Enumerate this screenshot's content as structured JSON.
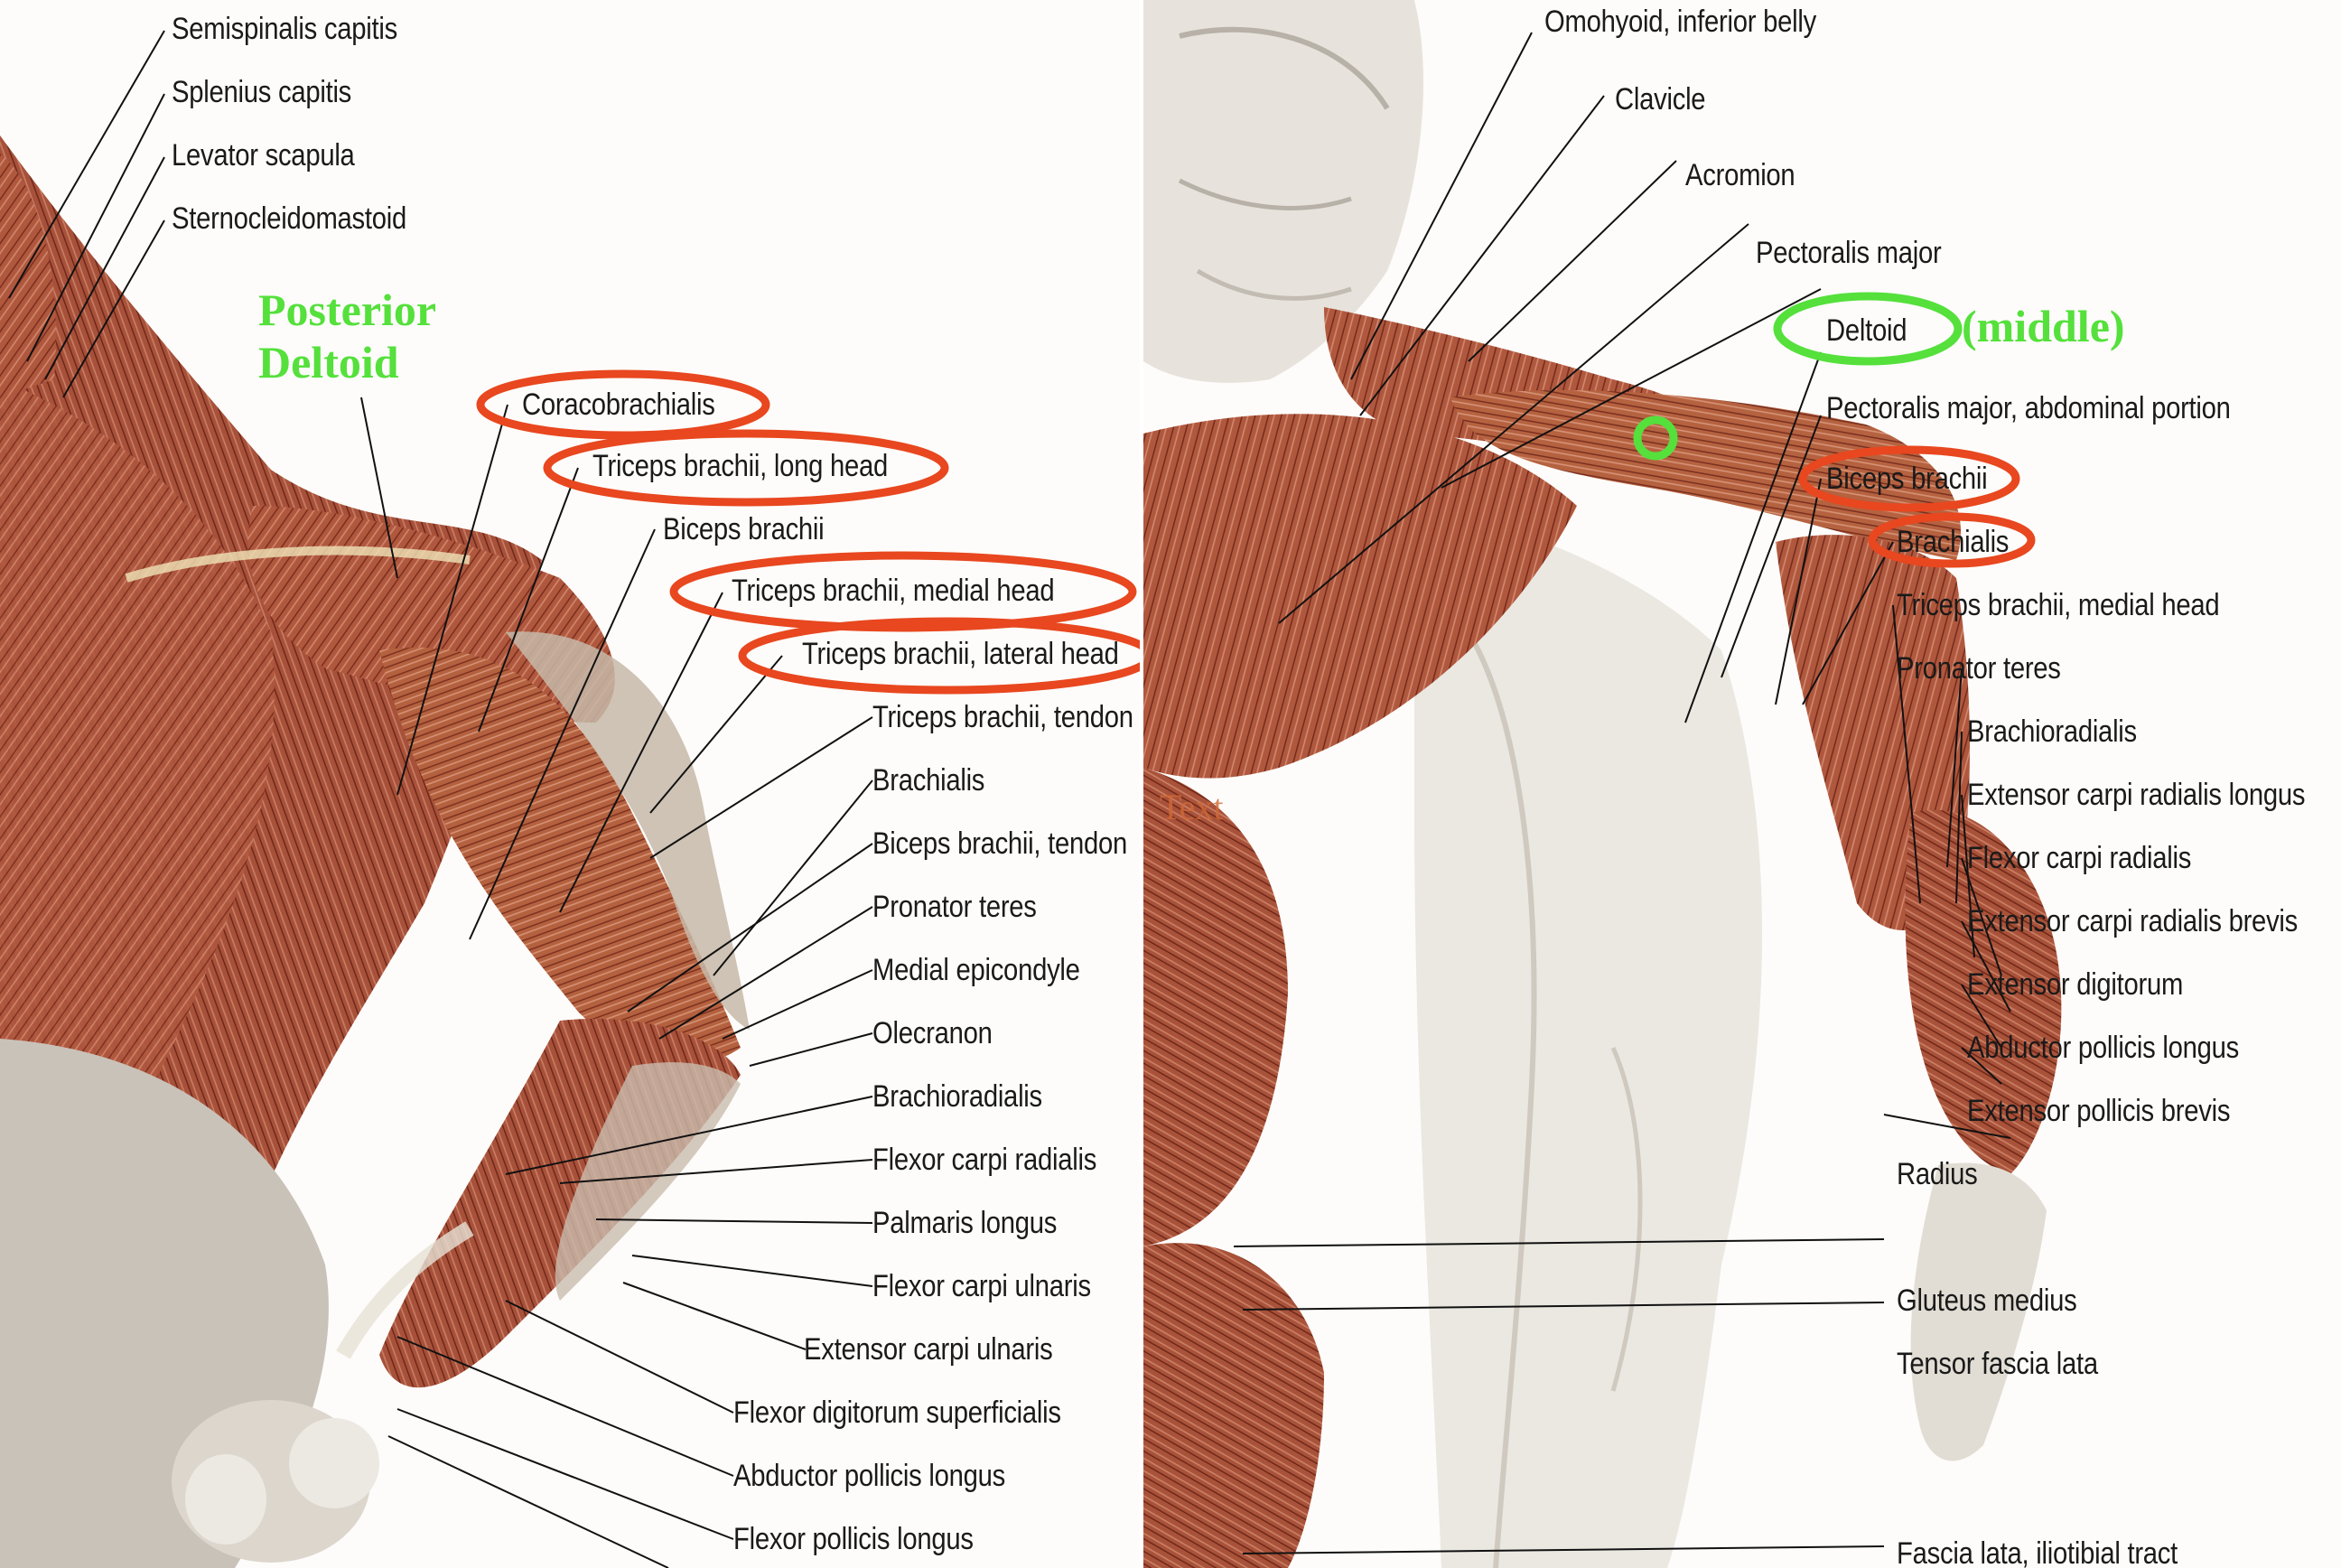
{
  "left_panel": {
    "heading": "Posterior Deltoid",
    "heading_color": "#55e03c",
    "highlight_color": "#e8471f",
    "labels": [
      "Semispinalis capitis",
      "Splenius capitis",
      "Levator scapula",
      "Sternocleidomastoid",
      "Coracobrachialis",
      "Triceps brachii, long head",
      "Biceps brachii",
      "Triceps brachii, medial head",
      "Triceps brachii, lateral head",
      "Triceps brachii, tendon",
      "Brachialis",
      "Biceps brachii, tendon",
      "Pronator teres",
      "Medial epicondyle",
      "Olecranon",
      "Brachioradialis",
      "Flexor carpi radialis",
      "Palmaris longus",
      "Flexor carpi ulnaris",
      "Extensor carpi ulnaris",
      "Flexor digitorum superficialis",
      "Abductor pollicis longus",
      "Flexor pollicis longus"
    ],
    "circled": [
      "Coracobrachialis",
      "Triceps brachii, long head",
      "Triceps brachii, medial head",
      "Triceps brachii, lateral head"
    ]
  },
  "right_panel": {
    "heading_suffix": "(middle)",
    "overlay_word": "Text",
    "labels": [
      "Omohyoid, inferior belly",
      "Clavicle",
      "Acromion",
      "Pectoralis major",
      "Deltoid",
      "Pectoralis major, abdominal portion",
      "Biceps brachii",
      "Brachialis",
      "Triceps brachii, medial head",
      "Pronator teres",
      "Brachioradialis",
      "Extensor carpi radialis longus",
      "Flexor carpi radialis",
      "Extensor carpi radialis brevis",
      "Extensor digitorum",
      "Abductor pollicis longus",
      "Extensor pollicis brevis",
      "Radius",
      "Gluteus medius",
      "Tensor fascia lata",
      "Fascia lata, iliotibial tract"
    ],
    "circled_green": [
      "Deltoid"
    ],
    "circled_red": [
      "Biceps brachii",
      "Brachialis"
    ]
  }
}
